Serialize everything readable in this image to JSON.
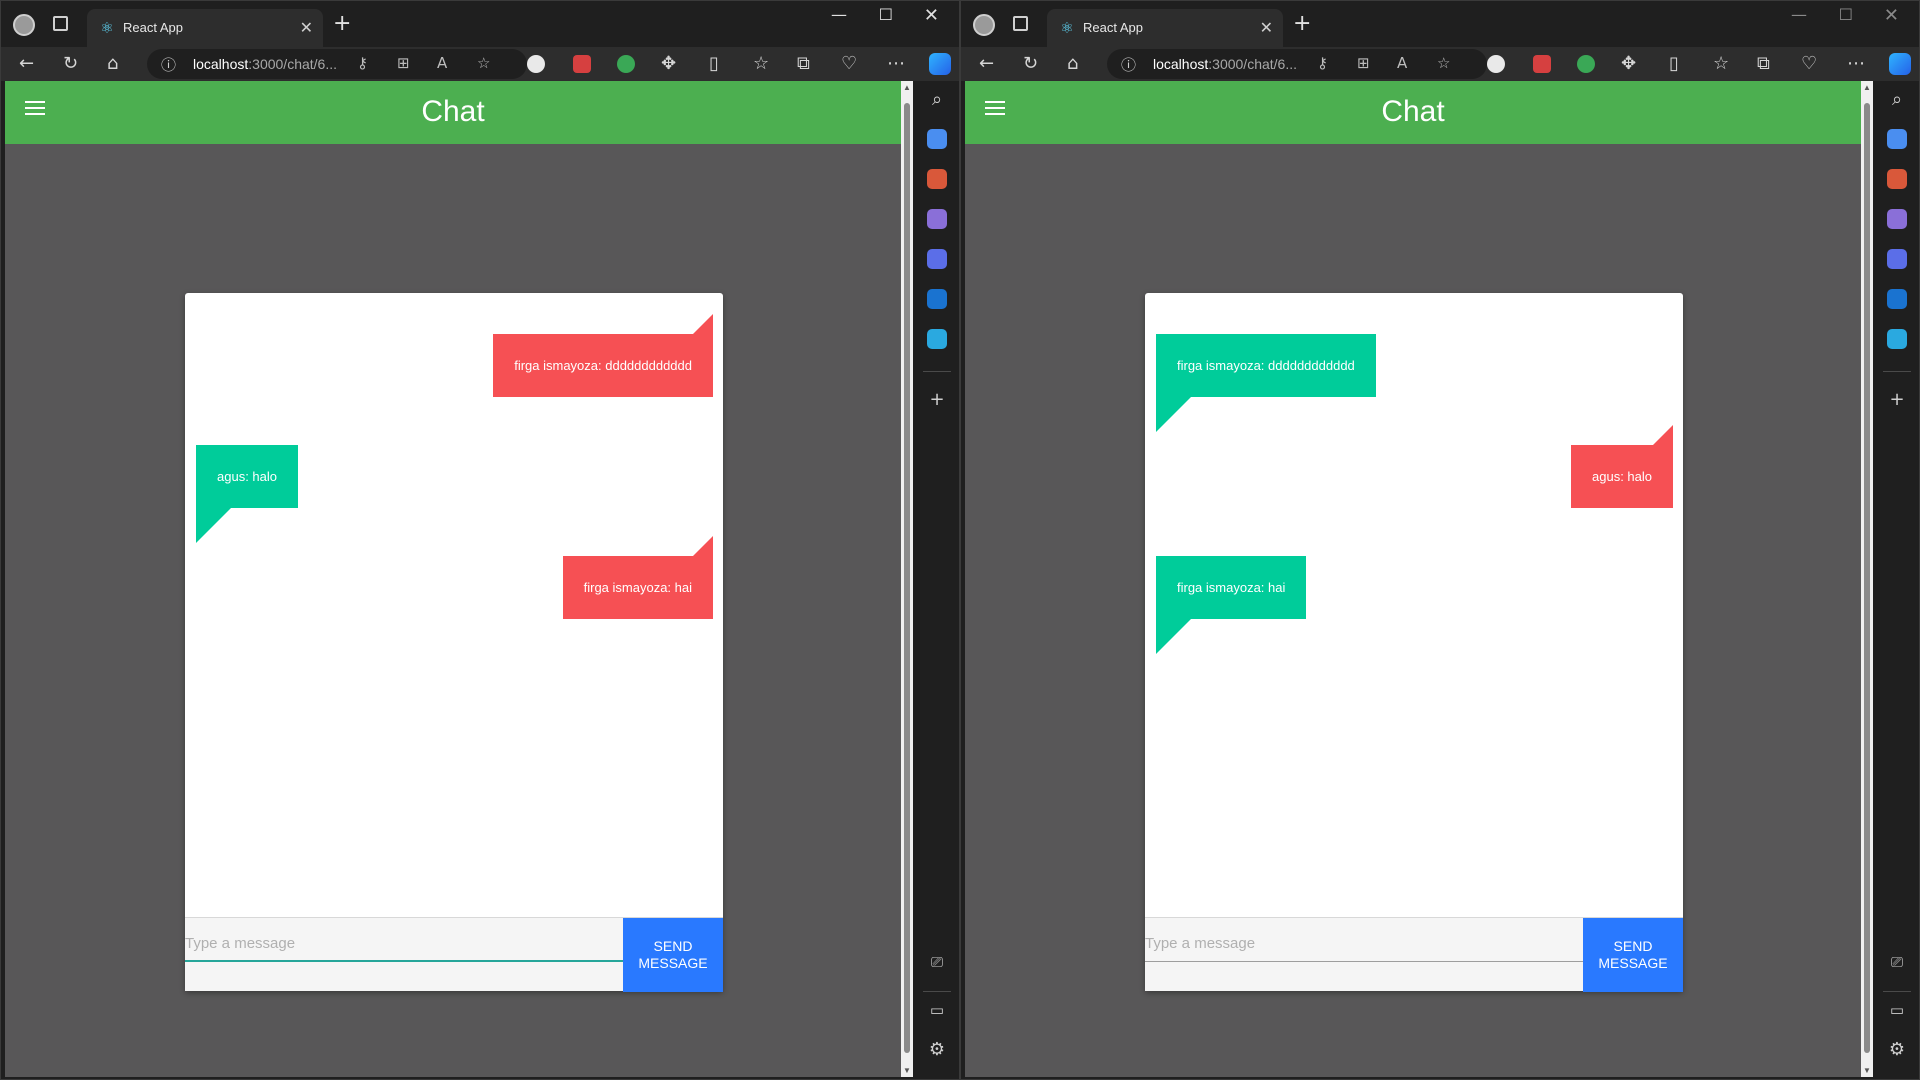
{
  "windows": [
    {
      "tab": {
        "title": "React App"
      },
      "address": {
        "host": "localhost",
        "rest": ":3000/chat/6..."
      },
      "app": {
        "title": "Chat"
      },
      "messages": [
        {
          "text": "firga ismayoza: dddddddddddd",
          "color": "#f65054",
          "side": "right"
        },
        {
          "text": "agus: halo",
          "color": "#00cc9a",
          "side": "left"
        },
        {
          "text": "firga ismayoza: hai",
          "color": "#f65054",
          "side": "right"
        }
      ],
      "composer": {
        "placeholder": "Type a message",
        "send_label": "SEND MESSAGE",
        "focused": true
      }
    },
    {
      "tab": {
        "title": "React App"
      },
      "address": {
        "host": "localhost",
        "rest": ":3000/chat/6..."
      },
      "app": {
        "title": "Chat"
      },
      "messages": [
        {
          "text": "firga ismayoza: dddddddddddd",
          "color": "#00cc9a",
          "side": "left"
        },
        {
          "text": "agus: halo",
          "color": "#f65054",
          "side": "right"
        },
        {
          "text": "firga ismayoza: hai",
          "color": "#00cc9a",
          "side": "left"
        }
      ],
      "composer": {
        "placeholder": "Type a message",
        "send_label": "SEND MESSAGE",
        "focused": false
      }
    }
  ],
  "colors": {
    "app_bar": "#4caf50",
    "background": "#585758",
    "send_button": "#2979ff"
  }
}
